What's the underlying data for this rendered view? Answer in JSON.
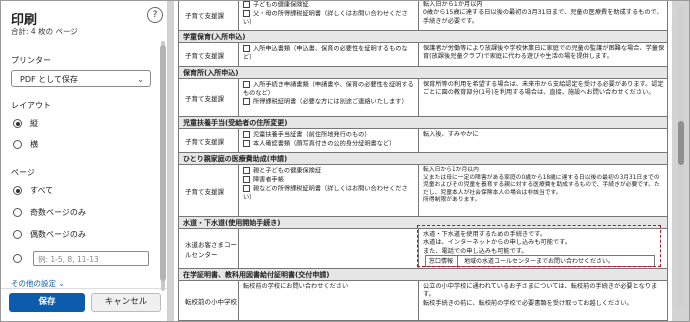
{
  "print_panel": {
    "title": "印刷",
    "subtitle": "合計: 4 枚の ページ",
    "help_label": "?",
    "printer_label": "プリンター",
    "printer_value": "PDF として保存",
    "layout_label": "レイアウト",
    "layout_options": [
      "縦",
      "横"
    ],
    "layout_selected": "縦",
    "pages_label": "ページ",
    "pages_options": [
      "すべて",
      "奇数ページのみ",
      "偶数ページのみ"
    ],
    "pages_selected": "すべて",
    "pages_input_placeholder": "例: 1-5, 8, 11-13",
    "other_settings": "その他の設定 ⌄",
    "print_button": "保存",
    "cancel_button": "キャンセル"
  },
  "document": {
    "row1": {
      "c1": "子育て支援課",
      "c2_items": [
        "子どもの健康保険証",
        "父・母の所得課税証明書（詳しくはお問い合わせください）"
      ],
      "c3": "転入日から1か月以内\n0歳から15歳に達する日以後の最初の3月31日まで、児童の医療費を助成するもので、手続きが必要です。"
    },
    "sec_gakudo": "学童保育(入所申込)",
    "row2": {
      "c1": "子育て支援課",
      "c2_items": [
        "入所申込書類（申込書、保育の必要性を証明するものなど）"
      ],
      "c3": "保護者が労働等により放課後や学校休業日に家庭での児童の監護が困難な場合、学童保育(放課後児童クラブ)で家庭に代わる遊びや生活の場を提供します。"
    },
    "sec_hoikusho": "保育所(入所申込)",
    "row3": {
      "c1": "子育て支援課",
      "c2_items": [
        "入所手続き申請書類（申請書や、保育の必要性を証明するものなど）",
        "所得課税証明書（必要な方には別途ご連絡いたします）"
      ],
      "c3": "保育所等の利用を希望する場合は、未来市から支給認定を受ける必要があります。認定ごとに園の教育部分(1号)を利用する場合は、直接、施設へお問い合わせください。"
    },
    "sec_jido": "児童扶養手当(受給者の住所変更)",
    "row4": {
      "c1": "子育て支援課",
      "c2_items": [
        "児童扶養手当証書（前住所地発行のもの）",
        "本人確認書類（顔写真付きの公的身分証明書など）"
      ],
      "c3": "転入後、すみやかに"
    },
    "sec_hitorioya": "ひとり親家庭の医療費助成(申請)",
    "row5": {
      "c1": "子育て支援課",
      "c2_items": [
        "親と子どもの健康保険証",
        "障害者手帳",
        "親などの所得課税証明書（詳しくはお問い合わせください）"
      ],
      "c3": "転入日から1か月以内\n父または母に一定の障害がある家庭の0歳から18歳に達する日以後の最初の3月31日までの児童およびその児童を養育する親に対する医療費を助成するもので、手続きが必要です。ただし、児童本人が社会保険本人の場合は非該当です。\n所得制限があります。"
    },
    "sec_suido": "水道・下水道(使用開始手続き)",
    "row6": {
      "c1": "水道お客さまコールセンター",
      "c2": "",
      "c3_lines": [
        "水道・下水道を使用するための手続きです。",
        "水道は、インターネットからの申し込みも可能です。",
        "また、電話での申し込みも可能です。"
      ],
      "inner_head": "窓口情報",
      "inner_text": "地域の水道コールセンターまでお問い合わせください。"
    },
    "sec_gakko": "在学証明書、教科用図書給付証明書(交付申請)",
    "row7": {
      "c1": "転校前の小中学校",
      "c2": "転校前の学校にお問い合わせください",
      "c3": "公立の小中学校に通われているお子さまについては、転校前の手続きが必要となります。\n転校手続きの前に、転校前の学校で必要書類を受け取ってお越しください。"
    }
  },
  "colors": {
    "accent": "#0b5cad",
    "highlight": "#c0121b"
  }
}
